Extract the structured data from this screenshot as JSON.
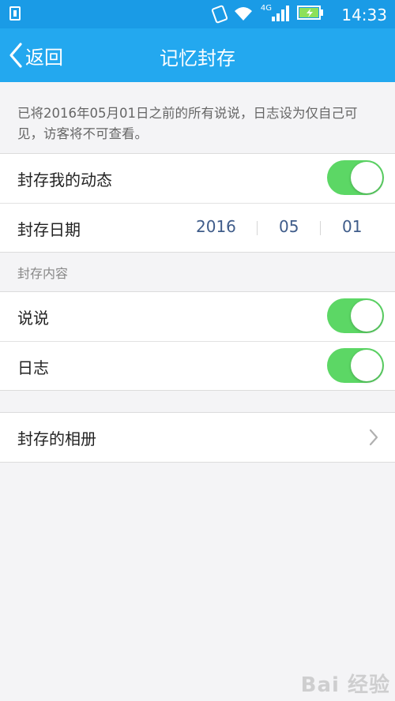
{
  "status_bar": {
    "time": "14:33",
    "network": "4G",
    "icons": [
      "usb-icon",
      "vibrate-icon",
      "wifi-icon",
      "signal-icon",
      "battery-icon"
    ]
  },
  "header": {
    "back_label": "返回",
    "title": "记忆封存"
  },
  "notice": "已将2016年05月01日之前的所有说说，日志设为仅自己可见，访客将不可查看。",
  "settings": {
    "seal_my_feed": {
      "label": "封存我的动态",
      "on": true
    },
    "seal_date": {
      "label": "封存日期",
      "year": "2016",
      "month": "05",
      "day": "01"
    }
  },
  "content_section": {
    "header": "封存内容",
    "items": [
      {
        "label": "说说",
        "on": true
      },
      {
        "label": "日志",
        "on": true
      }
    ]
  },
  "albums": {
    "label": "封存的相册"
  },
  "watermark": "Bai 经验",
  "colors": {
    "accent": "#23a8ef",
    "switch_on": "#5cd765",
    "date_text": "#3f5c8a"
  }
}
